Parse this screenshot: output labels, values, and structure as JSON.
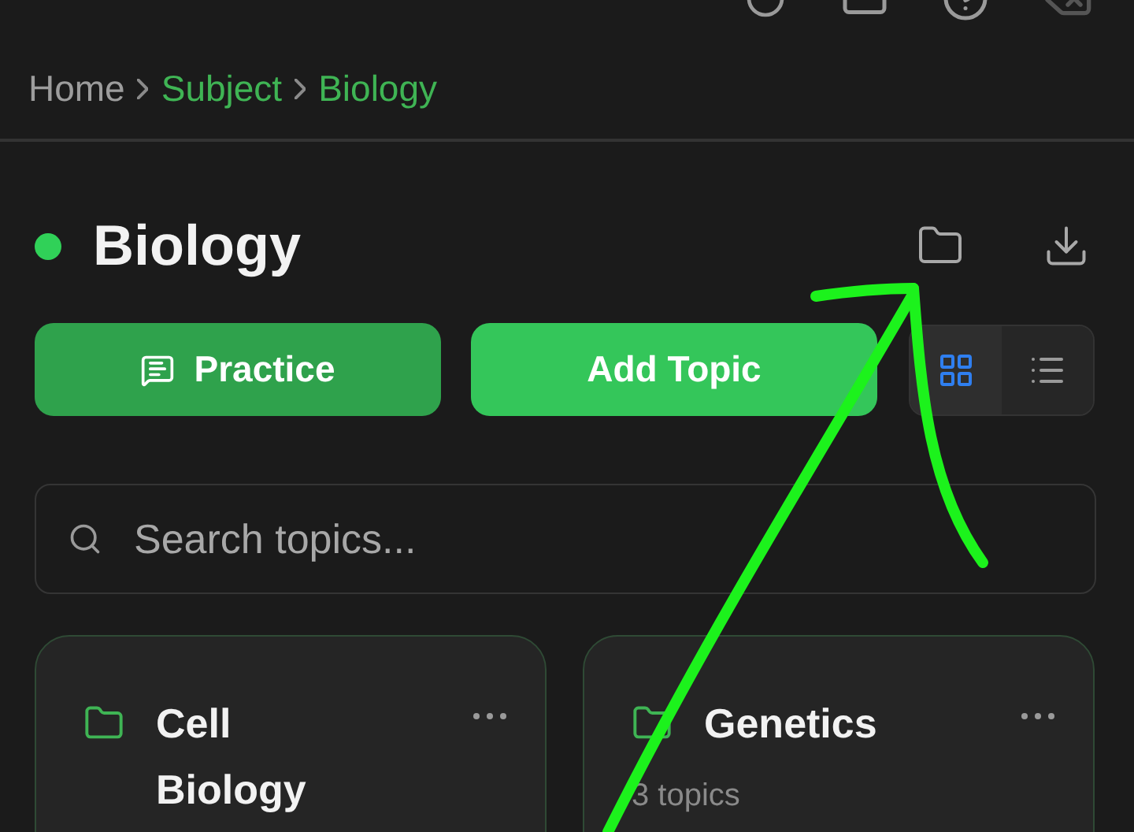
{
  "breadcrumb": [
    {
      "label": "Home",
      "current": false
    },
    {
      "label": "Subject",
      "current": true
    },
    {
      "label": "Biology",
      "current": true
    }
  ],
  "subject": {
    "title": "Biology",
    "color": "#30d158"
  },
  "actions": [
    {
      "label": "Practice",
      "kind": "practice"
    },
    {
      "label": "Add Topic",
      "kind": "add"
    }
  ],
  "view_toggle": [
    {
      "kind": "grid",
      "selected": true
    },
    {
      "kind": "list",
      "selected": false
    }
  ],
  "search": {
    "placeholder": "Search topics..."
  },
  "topics": [
    {
      "title": "Cell Biology"
    },
    {
      "title": "Genetics",
      "count": "3 topics"
    }
  ]
}
